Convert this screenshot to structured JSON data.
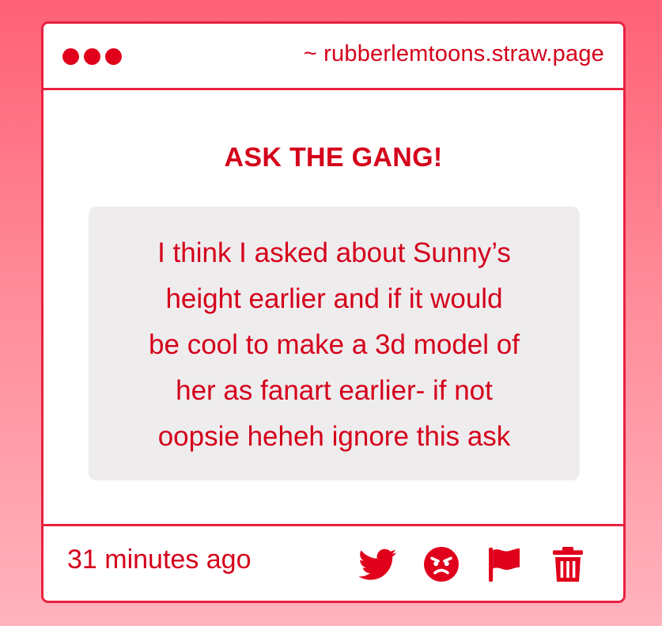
{
  "window": {
    "url": "~ rubberlemtoons.straw.page",
    "controls": [
      "dot",
      "dot",
      "dot"
    ]
  },
  "content": {
    "heading": "ASK THE GANG!",
    "ask_lines": [
      "I think I asked about Sunny’s",
      "height earlier and if it would",
      "be cool to make a 3d model of",
      "her as fanart earlier- if not",
      "oopsie heheh ignore this ask"
    ]
  },
  "footer": {
    "timestamp": "31 minutes ago",
    "actions": [
      "twitter-icon",
      "angry-face-icon",
      "flag-icon",
      "trash-icon"
    ]
  },
  "colors": {
    "accent": "#e0001b",
    "border": "#e8213f",
    "box_bg": "#efecee",
    "bg_top": "#ff6176",
    "bg_bottom": "#ffb3bd"
  }
}
